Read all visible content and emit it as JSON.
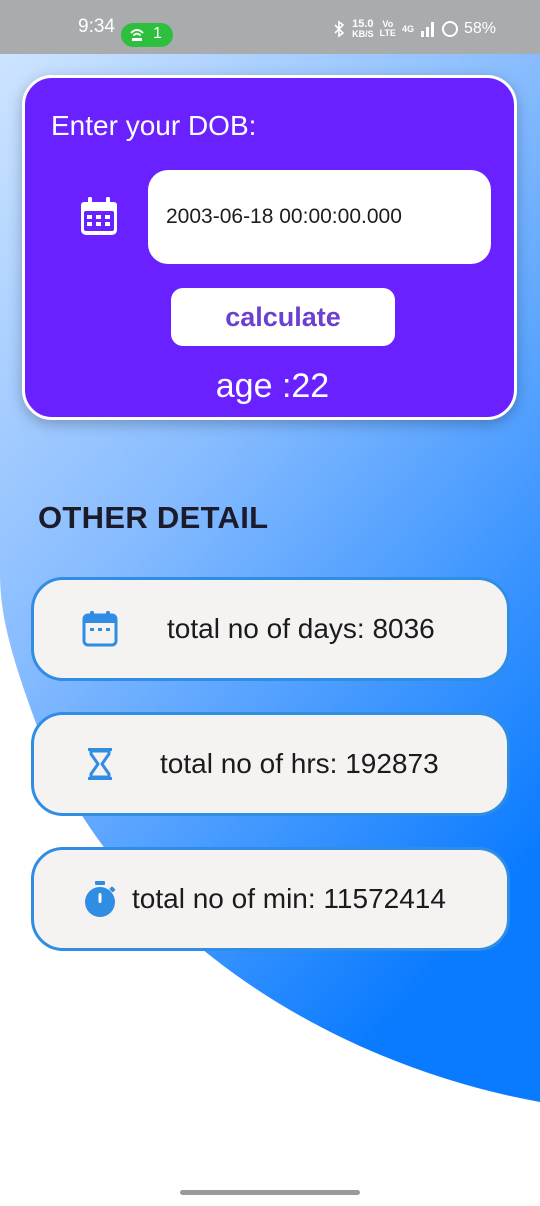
{
  "status_bar": {
    "time": "9:34",
    "hotspot_count": "1",
    "net_speed_value": "15.0",
    "net_speed_unit": "KB/S",
    "volte_top": "Vo",
    "volte_bottom": "LTE",
    "network": "4G",
    "battery": "58%"
  },
  "dob_card": {
    "label": "Enter your DOB:",
    "input_value": "2003-06-18 00:00:00.000",
    "calculate_label": "calculate",
    "age_text": "age :22"
  },
  "other_detail": {
    "heading": "OTHER DETAIL",
    "items": [
      {
        "icon": "calendar-icon",
        "text": "total no of days: 8036"
      },
      {
        "icon": "hourglass-icon",
        "text": "total no of hrs: 192873"
      },
      {
        "icon": "timer-icon",
        "text": "total no of min: 11572414"
      }
    ]
  },
  "colors": {
    "card_purple": "#6921ff",
    "accent_blue": "#2f8de4",
    "gradient_light": "#c3deff",
    "gradient_dark": "#0a7bff"
  }
}
